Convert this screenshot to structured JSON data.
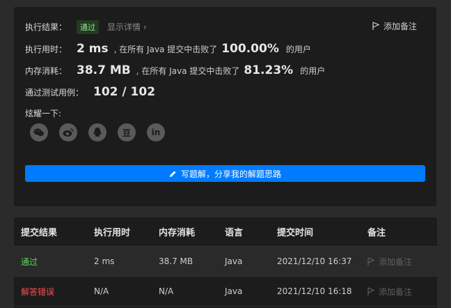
{
  "summary": {
    "result_label": "执行结果：",
    "result_status": "通过",
    "details_link": "显示详情 ›",
    "add_note": "添加备注",
    "runtime_label": "执行用时：",
    "runtime_value": "2 ms",
    "runtime_mid": ", 在所有 Java 提交中击败了",
    "runtime_pct": "100.00%",
    "runtime_tail": "的用户",
    "memory_label": "内存消耗：",
    "memory_value": "38.7 MB",
    "memory_mid": ", 在所有 Java 提交中击败了",
    "memory_pct": "81.23%",
    "memory_tail": "的用户",
    "tests_label": "通过测试用例：",
    "tests_value": "102 / 102",
    "share_label": "炫耀一下:",
    "share_icons": [
      "wechat-icon",
      "weibo-icon",
      "qq-icon",
      "douban-icon",
      "linkedin-icon"
    ],
    "douban_glyph": "豆",
    "linkedin_glyph": "in",
    "solution_button": "写题解，分享我的解题思路"
  },
  "table": {
    "headers": [
      "提交结果",
      "执行用时",
      "内存消耗",
      "语言",
      "提交时间",
      "备注"
    ],
    "rows": [
      {
        "result": "通过",
        "runtime": "2 ms",
        "memory": "38.7 MB",
        "language": "Java",
        "time": "2021/12/10 16:37",
        "note": "添加备注"
      },
      {
        "result": "解答错误",
        "runtime": "N/A",
        "memory": "N/A",
        "language": "Java",
        "time": "2021/12/10 16:18",
        "note": "添加备注"
      }
    ]
  },
  "colors": {
    "accent": "#007bff",
    "accepted": "#5cd65c",
    "wrong": "#ff4d4f"
  }
}
